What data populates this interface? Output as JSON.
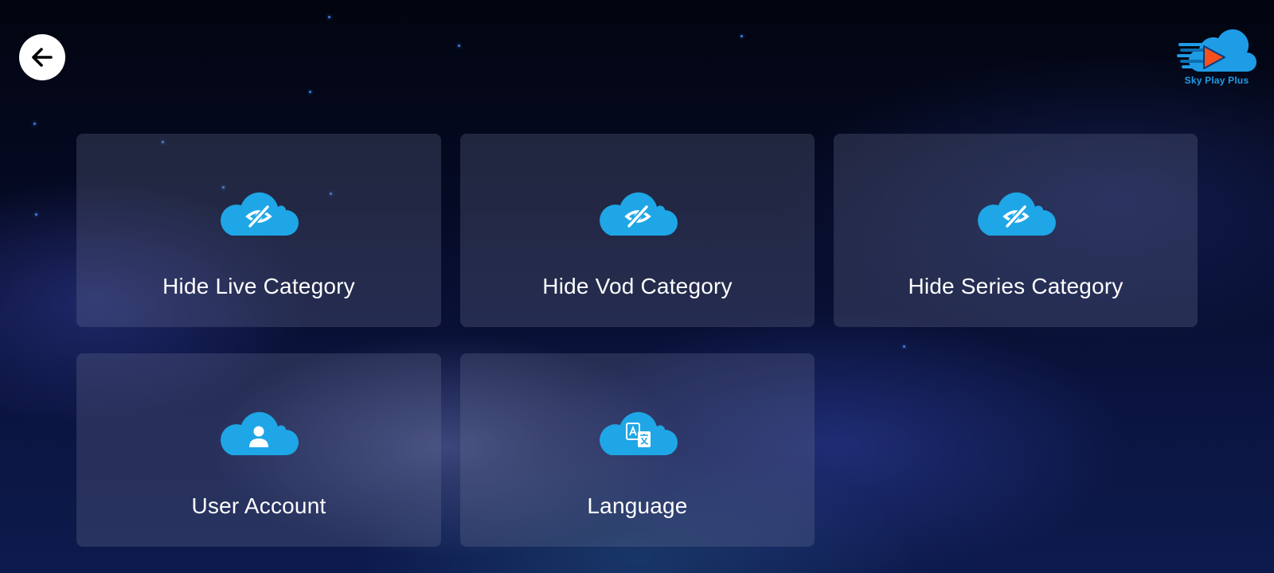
{
  "header": {
    "back_icon": "arrow-left-icon",
    "logo": {
      "name": "Sky Play Plus",
      "icon": "cloud-play-logo",
      "brand_color": "#1e9ce6",
      "accent_color": "#f5501e"
    }
  },
  "menu": {
    "items": [
      {
        "label": "Hide Live Category",
        "icon": "cloud-eye-slash-icon"
      },
      {
        "label": "Hide Vod Category",
        "icon": "cloud-eye-slash-icon"
      },
      {
        "label": "Hide Series Category",
        "icon": "cloud-eye-slash-icon"
      },
      {
        "label": "User Account",
        "icon": "cloud-user-icon"
      },
      {
        "label": "Language",
        "icon": "cloud-translate-icon"
      }
    ]
  },
  "colors": {
    "icon": "#1ea6e6",
    "card_bg": "rgba(110,118,150,0.28)",
    "text": "#ffffff"
  }
}
